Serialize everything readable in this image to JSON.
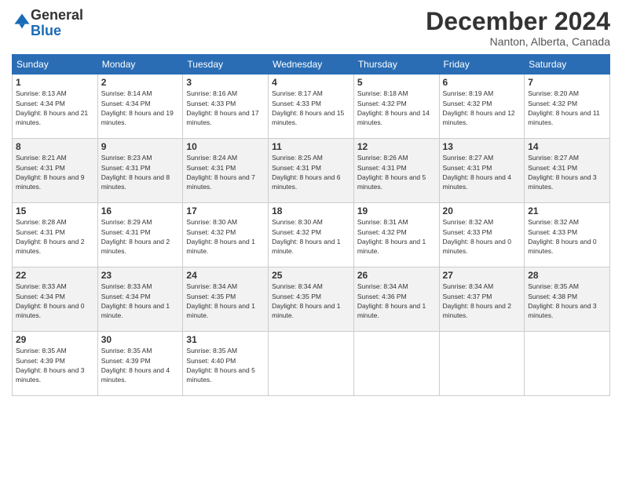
{
  "header": {
    "logo_general": "General",
    "logo_blue": "Blue",
    "month": "December 2024",
    "location": "Nanton, Alberta, Canada"
  },
  "days_of_week": [
    "Sunday",
    "Monday",
    "Tuesday",
    "Wednesday",
    "Thursday",
    "Friday",
    "Saturday"
  ],
  "weeks": [
    [
      {
        "day": "1",
        "sunrise": "8:13 AM",
        "sunset": "4:34 PM",
        "daylight": "8 hours and 21 minutes."
      },
      {
        "day": "2",
        "sunrise": "8:14 AM",
        "sunset": "4:34 PM",
        "daylight": "8 hours and 19 minutes."
      },
      {
        "day": "3",
        "sunrise": "8:16 AM",
        "sunset": "4:33 PM",
        "daylight": "8 hours and 17 minutes."
      },
      {
        "day": "4",
        "sunrise": "8:17 AM",
        "sunset": "4:33 PM",
        "daylight": "8 hours and 15 minutes."
      },
      {
        "day": "5",
        "sunrise": "8:18 AM",
        "sunset": "4:32 PM",
        "daylight": "8 hours and 14 minutes."
      },
      {
        "day": "6",
        "sunrise": "8:19 AM",
        "sunset": "4:32 PM",
        "daylight": "8 hours and 12 minutes."
      },
      {
        "day": "7",
        "sunrise": "8:20 AM",
        "sunset": "4:32 PM",
        "daylight": "8 hours and 11 minutes."
      }
    ],
    [
      {
        "day": "8",
        "sunrise": "8:21 AM",
        "sunset": "4:31 PM",
        "daylight": "8 hours and 9 minutes."
      },
      {
        "day": "9",
        "sunrise": "8:23 AM",
        "sunset": "4:31 PM",
        "daylight": "8 hours and 8 minutes."
      },
      {
        "day": "10",
        "sunrise": "8:24 AM",
        "sunset": "4:31 PM",
        "daylight": "8 hours and 7 minutes."
      },
      {
        "day": "11",
        "sunrise": "8:25 AM",
        "sunset": "4:31 PM",
        "daylight": "8 hours and 6 minutes."
      },
      {
        "day": "12",
        "sunrise": "8:26 AM",
        "sunset": "4:31 PM",
        "daylight": "8 hours and 5 minutes."
      },
      {
        "day": "13",
        "sunrise": "8:27 AM",
        "sunset": "4:31 PM",
        "daylight": "8 hours and 4 minutes."
      },
      {
        "day": "14",
        "sunrise": "8:27 AM",
        "sunset": "4:31 PM",
        "daylight": "8 hours and 3 minutes."
      }
    ],
    [
      {
        "day": "15",
        "sunrise": "8:28 AM",
        "sunset": "4:31 PM",
        "daylight": "8 hours and 2 minutes."
      },
      {
        "day": "16",
        "sunrise": "8:29 AM",
        "sunset": "4:31 PM",
        "daylight": "8 hours and 2 minutes."
      },
      {
        "day": "17",
        "sunrise": "8:30 AM",
        "sunset": "4:32 PM",
        "daylight": "8 hours and 1 minute."
      },
      {
        "day": "18",
        "sunrise": "8:30 AM",
        "sunset": "4:32 PM",
        "daylight": "8 hours and 1 minute."
      },
      {
        "day": "19",
        "sunrise": "8:31 AM",
        "sunset": "4:32 PM",
        "daylight": "8 hours and 1 minute."
      },
      {
        "day": "20",
        "sunrise": "8:32 AM",
        "sunset": "4:33 PM",
        "daylight": "8 hours and 0 minutes."
      },
      {
        "day": "21",
        "sunrise": "8:32 AM",
        "sunset": "4:33 PM",
        "daylight": "8 hours and 0 minutes."
      }
    ],
    [
      {
        "day": "22",
        "sunrise": "8:33 AM",
        "sunset": "4:34 PM",
        "daylight": "8 hours and 0 minutes."
      },
      {
        "day": "23",
        "sunrise": "8:33 AM",
        "sunset": "4:34 PM",
        "daylight": "8 hours and 1 minute."
      },
      {
        "day": "24",
        "sunrise": "8:34 AM",
        "sunset": "4:35 PM",
        "daylight": "8 hours and 1 minute."
      },
      {
        "day": "25",
        "sunrise": "8:34 AM",
        "sunset": "4:35 PM",
        "daylight": "8 hours and 1 minute."
      },
      {
        "day": "26",
        "sunrise": "8:34 AM",
        "sunset": "4:36 PM",
        "daylight": "8 hours and 1 minute."
      },
      {
        "day": "27",
        "sunrise": "8:34 AM",
        "sunset": "4:37 PM",
        "daylight": "8 hours and 2 minutes."
      },
      {
        "day": "28",
        "sunrise": "8:35 AM",
        "sunset": "4:38 PM",
        "daylight": "8 hours and 3 minutes."
      }
    ],
    [
      {
        "day": "29",
        "sunrise": "8:35 AM",
        "sunset": "4:39 PM",
        "daylight": "8 hours and 3 minutes."
      },
      {
        "day": "30",
        "sunrise": "8:35 AM",
        "sunset": "4:39 PM",
        "daylight": "8 hours and 4 minutes."
      },
      {
        "day": "31",
        "sunrise": "8:35 AM",
        "sunset": "4:40 PM",
        "daylight": "8 hours and 5 minutes."
      },
      null,
      null,
      null,
      null
    ]
  ],
  "labels": {
    "sunrise": "Sunrise:",
    "sunset": "Sunset:",
    "daylight": "Daylight:"
  }
}
